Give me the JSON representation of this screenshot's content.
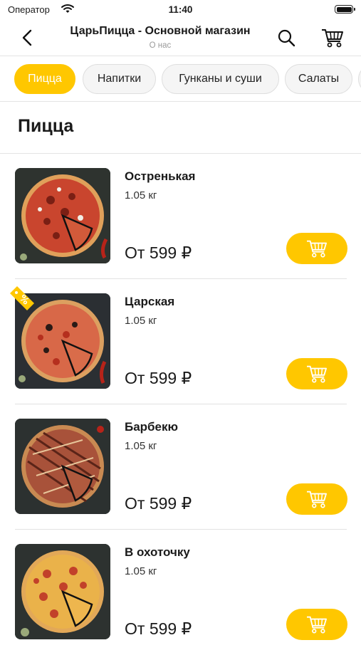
{
  "status_bar": {
    "carrier": "Оператор",
    "time": "11:40"
  },
  "nav": {
    "title": "ЦарьПицца - Основной магазин",
    "subtitle": "О нас",
    "back_icon": "chevron-left-icon",
    "search_icon": "search-icon",
    "cart_icon": "cart-icon"
  },
  "categories": [
    {
      "label": "Пицца",
      "active": true
    },
    {
      "label": "Напитки",
      "active": false
    },
    {
      "label": "Гунканы и суши",
      "active": false
    },
    {
      "label": "Салаты",
      "active": false
    }
  ],
  "section_title": "Пицца",
  "products": [
    {
      "name": "Остренькая",
      "weight": "1.05 кг",
      "price": "От 599 ₽",
      "promo": false
    },
    {
      "name": "Царская",
      "weight": "1.05 кг",
      "price": "От 599 ₽",
      "promo": true
    },
    {
      "name": "Барбекю",
      "weight": "1.05 кг",
      "price": "От 599 ₽",
      "promo": false
    },
    {
      "name": "В охоточку",
      "weight": "1.05 кг",
      "price": "От 599 ₽",
      "promo": false
    }
  ],
  "colors": {
    "accent": "#ffc700",
    "divider": "#e4e4e4",
    "chip_bg": "#f5f5f5"
  }
}
